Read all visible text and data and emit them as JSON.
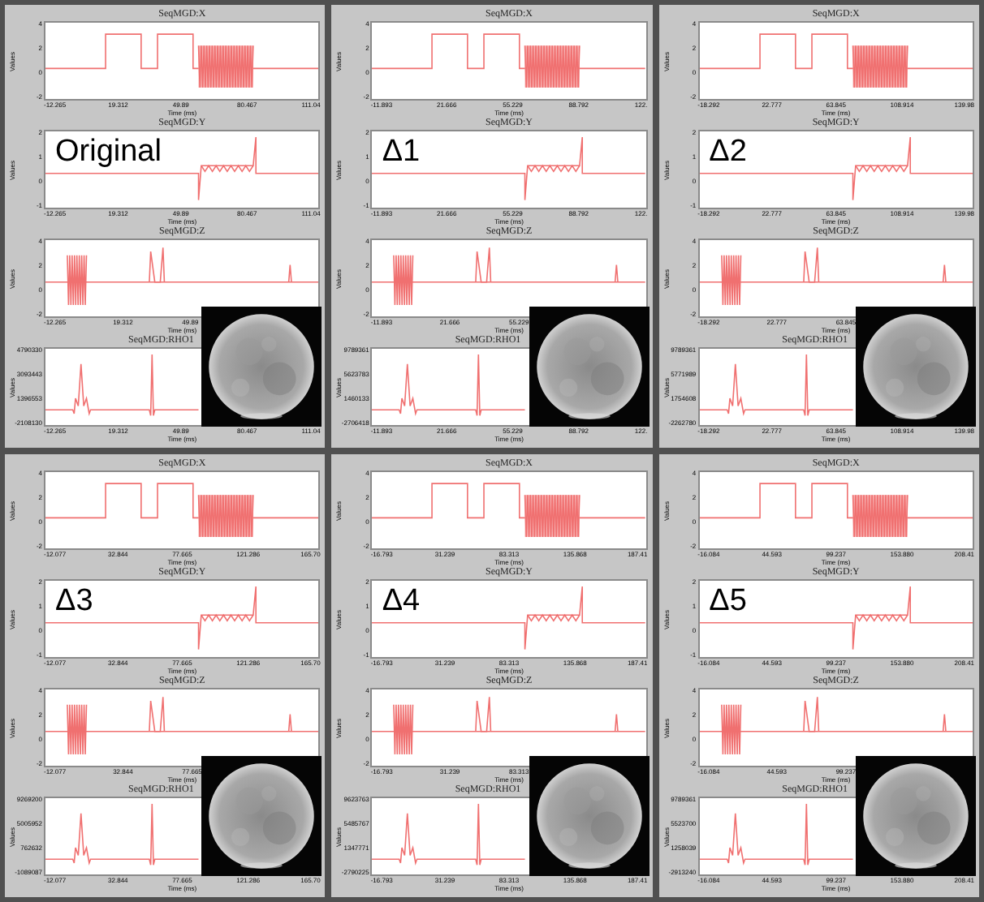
{
  "panels": [
    {
      "label": "Original",
      "plots": [
        {
          "kind": "x",
          "title": "SeqMGD:X",
          "ylabel": "Values",
          "yticks": [
            "4",
            "2",
            "0",
            "-2"
          ],
          "xticks": [
            "-12.265",
            "19.312",
            "49.89",
            "80.467",
            "111.04"
          ],
          "xlabel": "Time (ms)"
        },
        {
          "kind": "y",
          "title": "SeqMGD:Y",
          "ylabel": "Values",
          "yticks": [
            "2",
            "1",
            "0",
            "-1"
          ],
          "xticks": [
            "-12.265",
            "19.312",
            "49.89",
            "80.467",
            "111.04"
          ],
          "xlabel": "Time (ms)"
        },
        {
          "kind": "z",
          "title": "SeqMGD:Z",
          "ylabel": "Values",
          "yticks": [
            "4",
            "2",
            "0",
            "-2"
          ],
          "xticks": [
            "-12.265",
            "19.312",
            "49.89"
          ],
          "xlabel": "Time (ms)"
        },
        {
          "kind": "rho",
          "title": "SeqMGD:RHO1",
          "ylabel": "Values",
          "yticks": [
            "4790330",
            "3093443",
            "1396553",
            "-2108130"
          ],
          "xticks": [
            "-12.265",
            "19.312",
            "49.89",
            "80.467",
            "111.04"
          ],
          "xlabel": "Time (ms)"
        }
      ]
    },
    {
      "label": "Δ1",
      "plots": [
        {
          "kind": "x",
          "title": "SeqMGD:X",
          "ylabel": "Values",
          "yticks": [
            "4",
            "2",
            "0",
            "-2"
          ],
          "xticks": [
            "-11.893",
            "21.666",
            "55.229",
            "88.792",
            "122."
          ],
          "xlabel": "Time (ms)"
        },
        {
          "kind": "y",
          "title": "SeqMGD:Y",
          "ylabel": "Values",
          "yticks": [
            "2",
            "1",
            "0",
            "-1"
          ],
          "xticks": [
            "-11.893",
            "21.666",
            "55.229",
            "88.792",
            "122."
          ],
          "xlabel": "Time (ms)"
        },
        {
          "kind": "z",
          "title": "SeqMGD:Z",
          "ylabel": "Values",
          "yticks": [
            "4",
            "2",
            "0",
            "-2"
          ],
          "xticks": [
            "-11.893",
            "21.666",
            "55.229"
          ],
          "xlabel": "Time (ms)"
        },
        {
          "kind": "rho",
          "title": "SeqMGD:RHO1",
          "ylabel": "Values",
          "yticks": [
            "9789361",
            "5623783",
            "1460133",
            "-2706418"
          ],
          "xticks": [
            "-11.893",
            "21.666",
            "55.229",
            "88.792",
            "122."
          ],
          "xlabel": "Time (ms)"
        }
      ]
    },
    {
      "label": "Δ2",
      "plots": [
        {
          "kind": "x",
          "title": "SeqMGD:X",
          "ylabel": "Values",
          "yticks": [
            "4",
            "2",
            "0",
            "-2"
          ],
          "xticks": [
            "-18.292",
            "22.777",
            "63.845",
            "108.914",
            "139.98"
          ],
          "xlabel": "Time (ms)"
        },
        {
          "kind": "y",
          "title": "SeqMGD:Y",
          "ylabel": "Values",
          "yticks": [
            "2",
            "1",
            "0",
            "-1"
          ],
          "xticks": [
            "-18.292",
            "22.777",
            "63.845",
            "108.914",
            "139.98"
          ],
          "xlabel": "Time (ms)"
        },
        {
          "kind": "z",
          "title": "SeqMGD:Z",
          "ylabel": "Values",
          "yticks": [
            "4",
            "2",
            "0",
            "-2"
          ],
          "xticks": [
            "-18.292",
            "22.777",
            "63.845"
          ],
          "xlabel": "Time (ms)"
        },
        {
          "kind": "rho",
          "title": "SeqMGD:RHO1",
          "ylabel": "Values",
          "yticks": [
            "9789361",
            "5771989",
            "1754608",
            "-2262780"
          ],
          "xticks": [
            "-18.292",
            "22.777",
            "63.845",
            "108.914",
            "139.98"
          ],
          "xlabel": "Time (ms)"
        }
      ]
    },
    {
      "label": "Δ3",
      "plots": [
        {
          "kind": "x",
          "title": "SeqMGD:X",
          "ylabel": "Values",
          "yticks": [
            "4",
            "2",
            "0",
            "-2"
          ],
          "xticks": [
            "-12.077",
            "32.844",
            "77.665",
            "121.286",
            "165.70"
          ],
          "xlabel": "Time (ms)"
        },
        {
          "kind": "y",
          "title": "SeqMGD:Y",
          "ylabel": "Values",
          "yticks": [
            "2",
            "1",
            "0",
            "-1"
          ],
          "xticks": [
            "-12.077",
            "32.844",
            "77.665",
            "121.286",
            "165.70"
          ],
          "xlabel": "Time (ms)"
        },
        {
          "kind": "z",
          "title": "SeqMGD:Z",
          "ylabel": "Values",
          "yticks": [
            "4",
            "2",
            "0",
            "-2"
          ],
          "xticks": [
            "-12.077",
            "32.844",
            "77.665"
          ],
          "xlabel": "Time (ms)"
        },
        {
          "kind": "rho",
          "title": "SeqMGD:RHO1",
          "ylabel": "Values",
          "yticks": [
            "9269200",
            "5005952",
            "762632",
            "-1089087"
          ],
          "xticks": [
            "-12.077",
            "32.844",
            "77.665",
            "121.286",
            "165.70"
          ],
          "xlabel": "Time (ms)"
        }
      ]
    },
    {
      "label": "Δ4",
      "plots": [
        {
          "kind": "x",
          "title": "SeqMGD:X",
          "ylabel": "Values",
          "yticks": [
            "4",
            "2",
            "0",
            "-2"
          ],
          "xticks": [
            "-16.793",
            "31.239",
            "83.313",
            "135.868",
            "187.41"
          ],
          "xlabel": "Time (ms)"
        },
        {
          "kind": "y",
          "title": "SeqMGD:Y",
          "ylabel": "Values",
          "yticks": [
            "2",
            "1",
            "0",
            "-1"
          ],
          "xticks": [
            "-16.793",
            "31.239",
            "83.313",
            "135.868",
            "187.41"
          ],
          "xlabel": "Time (ms)"
        },
        {
          "kind": "z",
          "title": "SeqMGD:Z",
          "ylabel": "Values",
          "yticks": [
            "4",
            "2",
            "0",
            "-2"
          ],
          "xticks": [
            "-16.793",
            "31.239",
            "83.313"
          ],
          "xlabel": "Time (ms)"
        },
        {
          "kind": "rho",
          "title": "SeqMGD:RHO1",
          "ylabel": "Values",
          "yticks": [
            "9623763",
            "5485767",
            "1347771",
            "-2790225"
          ],
          "xticks": [
            "-16.793",
            "31.239",
            "83.313",
            "135.868",
            "187.41"
          ],
          "xlabel": "Time (ms)"
        }
      ]
    },
    {
      "label": "Δ5",
      "plots": [
        {
          "kind": "x",
          "title": "SeqMGD:X",
          "ylabel": "Values",
          "yticks": [
            "4",
            "2",
            "0",
            "-2"
          ],
          "xticks": [
            "-16.084",
            "44.593",
            "99.237",
            "153.880",
            "208.41"
          ],
          "xlabel": "Time (ms)"
        },
        {
          "kind": "y",
          "title": "SeqMGD:Y",
          "ylabel": "Values",
          "yticks": [
            "2",
            "1",
            "0",
            "-1"
          ],
          "xticks": [
            "-16.084",
            "44.593",
            "99.237",
            "153.880",
            "208.41"
          ],
          "xlabel": "Time (ms)"
        },
        {
          "kind": "z",
          "title": "SeqMGD:Z",
          "ylabel": "Values",
          "yticks": [
            "4",
            "2",
            "0",
            "-2"
          ],
          "xticks": [
            "-16.084",
            "44.593",
            "99.237"
          ],
          "xlabel": "Time (ms)"
        },
        {
          "kind": "rho",
          "title": "SeqMGD:RHO1",
          "ylabel": "Values",
          "yticks": [
            "9789361",
            "5523700",
            "1258039",
            "-2913240"
          ],
          "xticks": [
            "-16.084",
            "44.593",
            "99.237",
            "153.880",
            "208.41"
          ],
          "xlabel": "Time (ms)"
        }
      ]
    }
  ]
}
